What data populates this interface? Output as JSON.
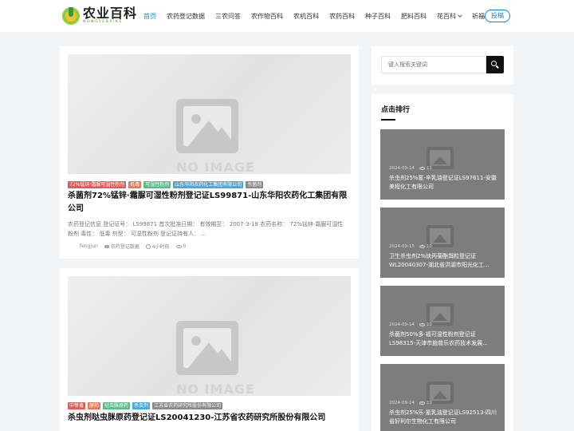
{
  "header": {
    "logo_title": "农业百科",
    "logo_sub": "NONGYEBAIKE",
    "nav": [
      {
        "label": "首页",
        "active": true
      },
      {
        "label": "农药登记数据"
      },
      {
        "label": "三农问答"
      },
      {
        "label": "农作物百科"
      },
      {
        "label": "农机百科"
      },
      {
        "label": "农药百科"
      },
      {
        "label": "种子百科"
      },
      {
        "label": "肥料百科"
      },
      {
        "label": "花百科",
        "caret": true
      },
      {
        "label": "祈福",
        "caret": true
      }
    ],
    "submit_label": "投稿"
  },
  "posts": [
    {
      "thumb_text": "NO IMAGE",
      "tags": [
        {
          "label": "72%锰锌·霜脲可湿性粉剂",
          "color": "#e05a5a"
        },
        {
          "label": "低毒",
          "color": "#e07a5a"
        },
        {
          "label": "可湿性粉剂",
          "color": "#5bb98c"
        },
        {
          "label": "山东华阳农药化工集团有限公司",
          "color": "#4aa7d8"
        },
        {
          "label": "杀菌剂",
          "color": "#8a8a8a"
        }
      ],
      "title": "杀菌剂72%锰锌·霜脲可湿性粉剂登记证LS99871-山东华阳农药化工集团有限公司",
      "excerpt": "农药登记信息 登记证号： LS99871 首次批准日期： 有效期至： 2007-3-18 农药名称： 72%锰锌·霜脲可湿性粉剂 毒性： 低毒 剂型： 可湿性粉剂 登记证持有人： ...",
      "author": "fengjun",
      "category": "农药登记数据",
      "time": "4小时前",
      "views": "0"
    },
    {
      "thumb_text": "NO IMAGE",
      "tags": [
        {
          "label": "中等毒",
          "color": "#e05a5a"
        },
        {
          "label": "原药",
          "color": "#e07a5a"
        },
        {
          "label": "哒虫脒原药",
          "color": "#5bb98c"
        },
        {
          "label": "杀虫剂",
          "color": "#4aa7d8"
        },
        {
          "label": "江苏省农药研究所股份有限公司",
          "color": "#8a8a8a"
        }
      ],
      "title": "杀虫剂哒虫脒原药登记证LS20041230-江苏省农药研究所股份有限公司"
    }
  ],
  "sidebar": {
    "search_placeholder": "键入搜索关键词",
    "hot_title": "点击排行",
    "hot_items": [
      {
        "date": "2024-09-14",
        "views": "11",
        "title": "杀虫剂25%氰·辛乳油登记证LS97611-安徽美程化工有限公司"
      },
      {
        "date": "2024-09-15",
        "views": "10",
        "title": "卫生杀虫剂2%炔丙菊酯饵粒登记证WL20040307-湖北省洪湖市阳光化工..."
      },
      {
        "date": "2024-09-14",
        "views": "10",
        "title": "杀菌剂50%多·福可湿性粉剂登记证LS98315-天津市施普乐农药技术发展..."
      },
      {
        "date": "2024-09-14",
        "views": "10",
        "title": "杀虫剂25%乐·氰乳油登记证LS92513-四川省好利尔生物化工有限公司"
      }
    ]
  }
}
